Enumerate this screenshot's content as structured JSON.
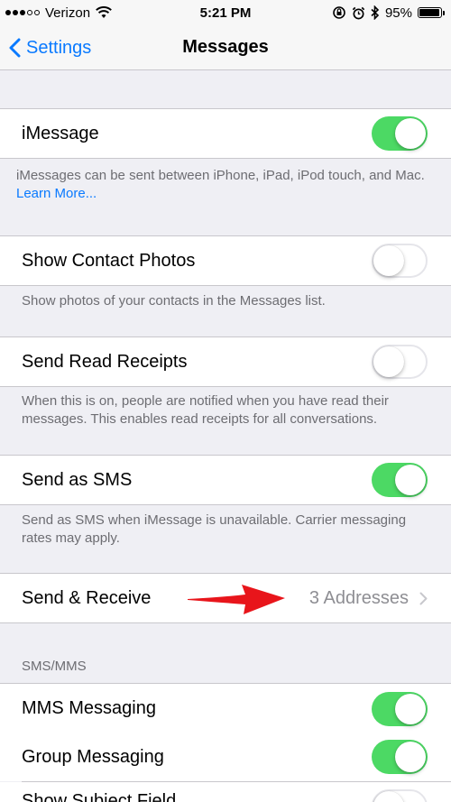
{
  "status_bar": {
    "carrier": "Verizon",
    "time": "5:21 PM",
    "battery": "95%",
    "battery_level": 0.95,
    "icons": [
      "signal-dots-icon",
      "wifi-icon",
      "orientation-lock-icon",
      "alarm-icon",
      "bluetooth-icon",
      "battery-icon"
    ]
  },
  "nav": {
    "back_label": "Settings",
    "title": "Messages"
  },
  "rows": {
    "imessage": {
      "label": "iMessage",
      "on": true
    },
    "imessage_footer": "iMessages can be sent between iPhone, iPad, iPod touch, and Mac.",
    "imessage_footer_link": "Learn More...",
    "contact_photos": {
      "label": "Show Contact Photos",
      "on": false
    },
    "contact_photos_footer": "Show photos of your contacts in the Messages list.",
    "read_receipts": {
      "label": "Send Read Receipts",
      "on": false
    },
    "read_receipts_footer": "When this is on, people are notified when you have read their messages. This enables read receipts for all conversations.",
    "send_sms": {
      "label": "Send as SMS",
      "on": true
    },
    "send_sms_footer": "Send as SMS when iMessage is unavailable. Carrier messaging rates may apply.",
    "send_receive": {
      "label": "Send & Receive",
      "value": "3 Addresses"
    },
    "sms_header": "SMS/MMS",
    "mms": {
      "label": "MMS Messaging",
      "on": true
    },
    "group": {
      "label": "Group Messaging",
      "on": true
    },
    "subject": {
      "label": "Show Subject Field",
      "on": false
    }
  },
  "colors": {
    "accent": "#0a7aff",
    "toggle_on": "#4cd964",
    "annotation_arrow": "#e8151b",
    "background": "#efeff4"
  }
}
